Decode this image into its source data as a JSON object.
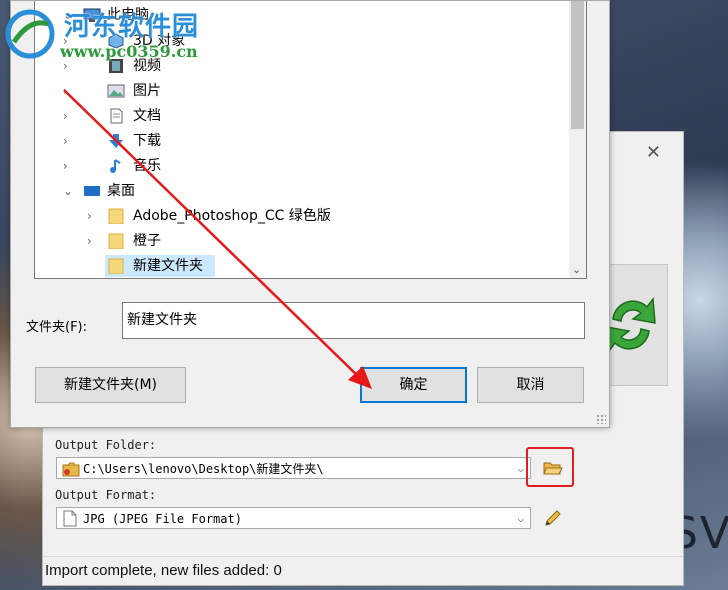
{
  "watermark": {
    "title": "河东软件园",
    "url": "www.pc0359.cn"
  },
  "background": {
    "letters": "SV"
  },
  "tree": {
    "items": [
      {
        "label": "此电脑",
        "icon": "computer-icon"
      },
      {
        "label": "3D 对象",
        "icon": "3d-objects-icon"
      },
      {
        "label": "视频",
        "icon": "video-icon"
      },
      {
        "label": "图片",
        "icon": "pictures-icon"
      },
      {
        "label": "文档",
        "icon": "documents-icon"
      },
      {
        "label": "下载",
        "icon": "download-icon"
      },
      {
        "label": "音乐",
        "icon": "music-icon"
      },
      {
        "label": "桌面",
        "icon": "desktop-icon"
      },
      {
        "label": "Adobe_Photoshop_CC  绿色版",
        "icon": "folder-icon"
      },
      {
        "label": "橙子",
        "icon": "folder-icon"
      },
      {
        "label": "新建文件夹",
        "icon": "folder-icon",
        "selected": true
      }
    ]
  },
  "dialog": {
    "folder_label": "文件夹(F):",
    "folder_value": "新建文件夹",
    "new_folder_button": "新建文件夹(M)",
    "ok_button": "确定",
    "cancel_button": "取消"
  },
  "app": {
    "output_folder_label": "Output Folder:",
    "output_folder_value": "C:\\Users\\lenovo\\Desktop\\新建文件夹\\",
    "output_format_label": "Output Format:",
    "output_format_value": "JPG (JPEG File Format)",
    "status": "Import complete, new files added: 0"
  },
  "colors": {
    "accent": "#0078d7",
    "highlight": "#e02020",
    "watermark_blue": "#2a8fd8",
    "watermark_green": "#2c9a3a"
  }
}
